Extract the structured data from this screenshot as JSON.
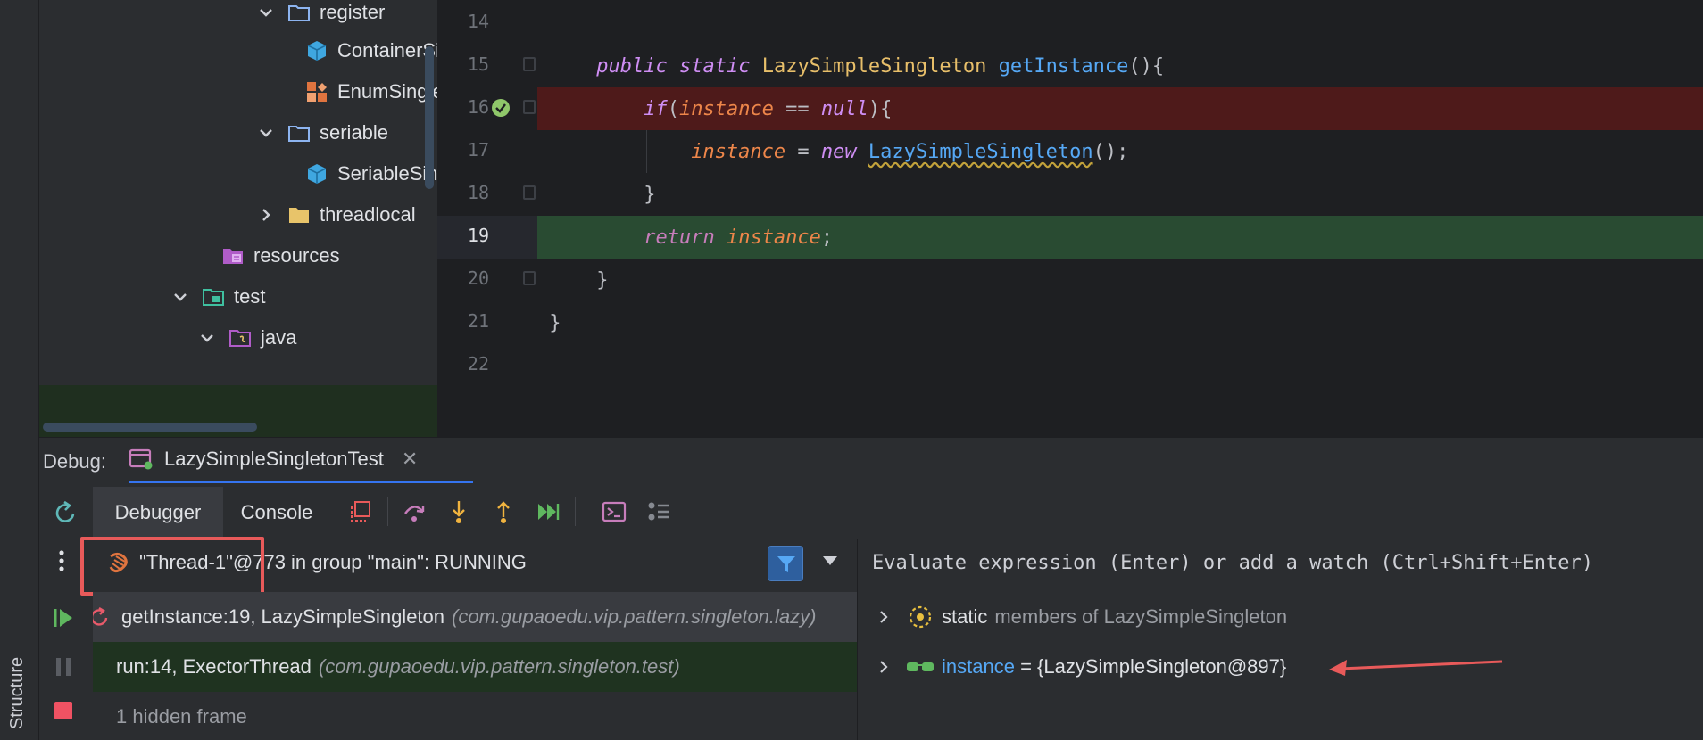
{
  "sidebar": {
    "structure_label": "Structure"
  },
  "project_tree": {
    "items": [
      {
        "label": "register",
        "type": "package"
      },
      {
        "label": "ContainerSingleton",
        "type": "class"
      },
      {
        "label": "EnumSingleton",
        "type": "enum"
      },
      {
        "label": "seriable",
        "type": "package"
      },
      {
        "label": "SeriableSingleton",
        "type": "class"
      },
      {
        "label": "threadlocal",
        "type": "folder"
      },
      {
        "label": "resources",
        "type": "resources"
      },
      {
        "label": "test",
        "type": "test-root"
      },
      {
        "label": "java",
        "type": "source-root"
      }
    ]
  },
  "editor": {
    "line_numbers": [
      "14",
      "15",
      "16",
      "17",
      "18",
      "19",
      "20",
      "21",
      "22"
    ],
    "current_line": "19"
  },
  "debug": {
    "label": "Debug:",
    "session_tab": "LazySimpleSingletonTest",
    "tabs": {
      "debugger": "Debugger",
      "console": "Console"
    },
    "thread": {
      "text": "\"Thread-1\"@773 in group \"main\": RUNNING"
    },
    "frames": [
      {
        "main": "getInstance:19, LazySimpleSingleton",
        "pkg": "(com.gupaoedu.vip.pattern.singleton.lazy)"
      },
      {
        "main": "run:14, ExectorThread",
        "pkg": "(com.gupaoedu.vip.pattern.singleton.test)"
      }
    ],
    "hidden_frames": "1 hidden frame",
    "evaluate_placeholder": "Evaluate expression (Enter) or add a watch (Ctrl+Shift+Enter)",
    "variables": {
      "static": {
        "prefix": "static",
        "rest": "members of LazySimpleSingleton"
      },
      "instance": {
        "name": "instance",
        "eq": " = ",
        "value": "{LazySimpleSingleton@897}"
      }
    }
  },
  "colors": {
    "breakpoint_line": "#4e1a1a",
    "execution_line": "#294b32",
    "annotation_red": "#e85a5a",
    "accent_blue": "#3574f0"
  }
}
